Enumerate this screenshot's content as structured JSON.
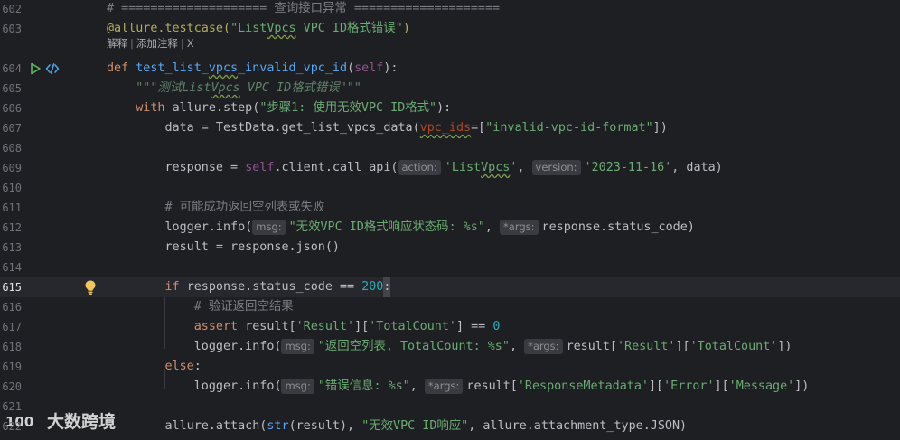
{
  "editor": {
    "current_line": "615",
    "inlay_hint_actions": {
      "explain": "解释",
      "add_comment": "添加注释",
      "close": "X"
    },
    "lines": [
      {
        "num": "602",
        "segments": [
          {
            "t": "# ==================== 查询接口异常 ====================",
            "c": "cmt"
          }
        ]
      },
      {
        "num": "603",
        "segments": [
          {
            "t": "@allure.testcase(",
            "c": "deco"
          },
          {
            "t": "\"List",
            "c": "str"
          },
          {
            "t": "Vpcs",
            "c": "str wavy"
          },
          {
            "t": " VPC ID格式错误\"",
            "c": "str"
          },
          {
            "t": ")",
            "c": "deco"
          }
        ]
      },
      {
        "num": "604",
        "segments": [
          {
            "t": "def ",
            "c": "kw"
          },
          {
            "t": "test_list_",
            "c": "fn"
          },
          {
            "t": "vpcs",
            "c": "fn wavy"
          },
          {
            "t": "_invalid_vpc_id",
            "c": "fn"
          },
          {
            "t": "(",
            "c": "plain"
          },
          {
            "t": "self",
            "c": "self"
          },
          {
            "t": "):",
            "c": "plain"
          }
        ]
      },
      {
        "num": "605",
        "segments": [
          {
            "t": "    \"\"\"测试List",
            "c": "doc"
          },
          {
            "t": "Vpcs",
            "c": "doc wavy"
          },
          {
            "t": " VPC ID格式错误\"\"\"",
            "c": "doc"
          }
        ]
      },
      {
        "num": "606",
        "segments": [
          {
            "t": "    ",
            "c": "plain"
          },
          {
            "t": "with ",
            "c": "kw"
          },
          {
            "t": "allure.step(",
            "c": "plain"
          },
          {
            "t": "\"步骤1: 使用无效VPC ID格式\"",
            "c": "str"
          },
          {
            "t": "):",
            "c": "plain"
          }
        ]
      },
      {
        "num": "607",
        "segments": [
          {
            "t": "        data = TestData.get_list_vpcs_data(",
            "c": "plain"
          },
          {
            "t": "vpc_ids",
            "c": "param wavy"
          },
          {
            "t": "=[",
            "c": "plain"
          },
          {
            "t": "\"invalid-vpc-id-format\"",
            "c": "str"
          },
          {
            "t": "])",
            "c": "plain"
          }
        ]
      },
      {
        "num": "608",
        "segments": []
      },
      {
        "num": "609",
        "segments": [
          {
            "t": "        response = ",
            "c": "plain"
          },
          {
            "t": "self",
            "c": "self"
          },
          {
            "t": ".client.call_api(",
            "c": "plain"
          },
          {
            "hint": "action:"
          },
          {
            "t": "'List",
            "c": "str"
          },
          {
            "t": "Vpcs",
            "c": "str wavy"
          },
          {
            "t": "'",
            "c": "str"
          },
          {
            "t": ", ",
            "c": "plain"
          },
          {
            "hint": "version:"
          },
          {
            "t": "'2023-11-16'",
            "c": "str"
          },
          {
            "t": ", data)",
            "c": "plain"
          }
        ]
      },
      {
        "num": "610",
        "segments": []
      },
      {
        "num": "611",
        "segments": [
          {
            "t": "        # 可能成功返回空列表或失败",
            "c": "cmt"
          }
        ]
      },
      {
        "num": "612",
        "segments": [
          {
            "t": "        logger.info(",
            "c": "plain"
          },
          {
            "hint": "msg:"
          },
          {
            "t": "\"无效VPC ID格式响应状态码: %s\"",
            "c": "str"
          },
          {
            "t": ", ",
            "c": "plain"
          },
          {
            "hint": "*args:"
          },
          {
            "t": "response.status_code)",
            "c": "plain"
          }
        ]
      },
      {
        "num": "613",
        "segments": [
          {
            "t": "        result = response.json()",
            "c": "plain"
          }
        ]
      },
      {
        "num": "614",
        "segments": []
      },
      {
        "num": "615",
        "segments": [
          {
            "t": "        ",
            "c": "plain"
          },
          {
            "t": "if ",
            "c": "kw"
          },
          {
            "t": "response.status_code == ",
            "c": "plain"
          },
          {
            "t": "200",
            "c": "num"
          },
          {
            "t": ":",
            "c": "caret-box"
          }
        ]
      },
      {
        "num": "616",
        "segments": [
          {
            "t": "            # 验证返回空结果",
            "c": "cmt"
          }
        ]
      },
      {
        "num": "617",
        "segments": [
          {
            "t": "            ",
            "c": "plain"
          },
          {
            "t": "assert ",
            "c": "kw"
          },
          {
            "t": "result[",
            "c": "plain"
          },
          {
            "t": "'Result'",
            "c": "str"
          },
          {
            "t": "][",
            "c": "plain"
          },
          {
            "t": "'TotalCount'",
            "c": "str"
          },
          {
            "t": "] == ",
            "c": "plain"
          },
          {
            "t": "0",
            "c": "num"
          }
        ]
      },
      {
        "num": "618",
        "segments": [
          {
            "t": "            logger.info(",
            "c": "plain"
          },
          {
            "hint": "msg:"
          },
          {
            "t": "\"返回空列表, TotalCount: %s\"",
            "c": "str"
          },
          {
            "t": ", ",
            "c": "plain"
          },
          {
            "hint": "*args:"
          },
          {
            "t": "result[",
            "c": "plain"
          },
          {
            "t": "'Result'",
            "c": "str"
          },
          {
            "t": "][",
            "c": "plain"
          },
          {
            "t": "'TotalCount'",
            "c": "str"
          },
          {
            "t": "])",
            "c": "plain"
          }
        ]
      },
      {
        "num": "619",
        "segments": [
          {
            "t": "        ",
            "c": "plain"
          },
          {
            "t": "else",
            "c": "kw"
          },
          {
            "t": ":",
            "c": "plain"
          }
        ]
      },
      {
        "num": "620",
        "segments": [
          {
            "t": "            logger.info(",
            "c": "plain"
          },
          {
            "hint": "msg:"
          },
          {
            "t": "\"错误信息: %s\"",
            "c": "str"
          },
          {
            "t": ", ",
            "c": "plain"
          },
          {
            "hint": "*args:"
          },
          {
            "t": "result[",
            "c": "plain"
          },
          {
            "t": "'ResponseMetadata'",
            "c": "str"
          },
          {
            "t": "][",
            "c": "plain"
          },
          {
            "t": "'Error'",
            "c": "str"
          },
          {
            "t": "][",
            "c": "plain"
          },
          {
            "t": "'Message'",
            "c": "str"
          },
          {
            "t": "])",
            "c": "plain"
          }
        ]
      },
      {
        "num": "621",
        "segments": []
      },
      {
        "num": "622",
        "segments": [
          {
            "t": "        allure.attach(",
            "c": "plain"
          },
          {
            "t": "str",
            "c": "fn"
          },
          {
            "t": "(result), ",
            "c": "plain"
          },
          {
            "t": "\"无效VPC ID响应\"",
            "c": "str"
          },
          {
            "t": ", allure.attachment_type.JSON)",
            "c": "plain"
          }
        ]
      }
    ]
  },
  "watermark": {
    "text": "大数跨境",
    "logo_mark": "100"
  },
  "icons": {
    "run": "run-triangle-icon",
    "debug": "code-link-icon",
    "bulb": "lightbulb-icon"
  },
  "colors": {
    "background": "#1e1f22",
    "keyword": "#cf8e6d",
    "string": "#6aab73",
    "comment": "#7a7e85",
    "function": "#56a8f5",
    "number": "#2aacb8"
  }
}
